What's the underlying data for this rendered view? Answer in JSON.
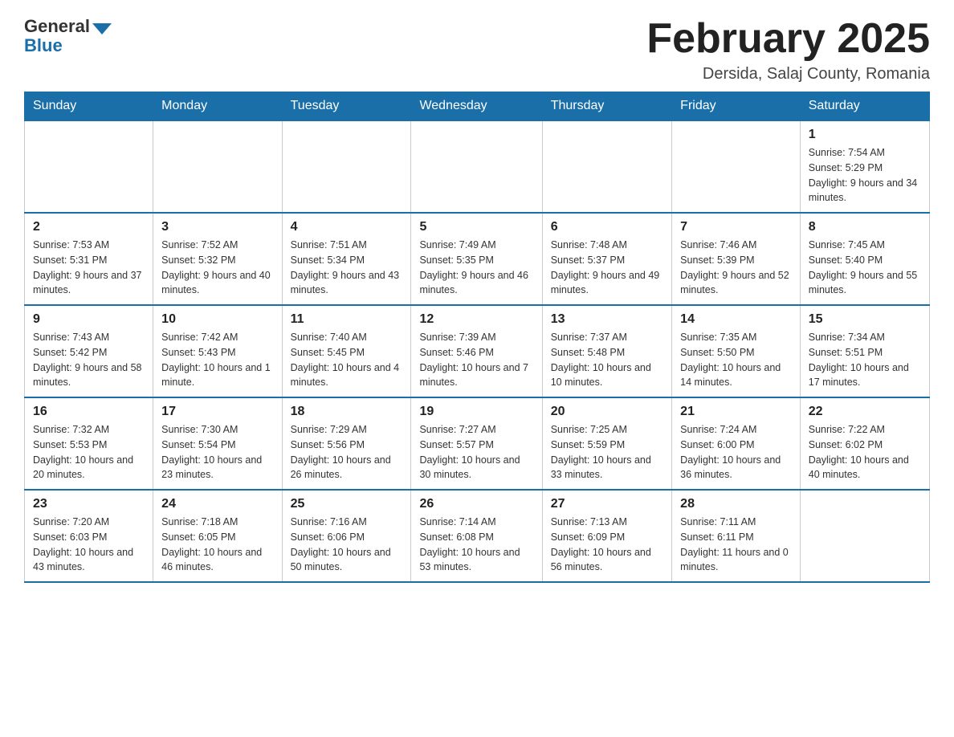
{
  "header": {
    "logo_general": "General",
    "logo_blue": "Blue",
    "month_title": "February 2025",
    "location": "Dersida, Salaj County, Romania"
  },
  "weekdays": [
    "Sunday",
    "Monday",
    "Tuesday",
    "Wednesday",
    "Thursday",
    "Friday",
    "Saturday"
  ],
  "weeks": [
    [
      {
        "day": "",
        "info": ""
      },
      {
        "day": "",
        "info": ""
      },
      {
        "day": "",
        "info": ""
      },
      {
        "day": "",
        "info": ""
      },
      {
        "day": "",
        "info": ""
      },
      {
        "day": "",
        "info": ""
      },
      {
        "day": "1",
        "info": "Sunrise: 7:54 AM\nSunset: 5:29 PM\nDaylight: 9 hours and 34 minutes."
      }
    ],
    [
      {
        "day": "2",
        "info": "Sunrise: 7:53 AM\nSunset: 5:31 PM\nDaylight: 9 hours and 37 minutes."
      },
      {
        "day": "3",
        "info": "Sunrise: 7:52 AM\nSunset: 5:32 PM\nDaylight: 9 hours and 40 minutes."
      },
      {
        "day": "4",
        "info": "Sunrise: 7:51 AM\nSunset: 5:34 PM\nDaylight: 9 hours and 43 minutes."
      },
      {
        "day": "5",
        "info": "Sunrise: 7:49 AM\nSunset: 5:35 PM\nDaylight: 9 hours and 46 minutes."
      },
      {
        "day": "6",
        "info": "Sunrise: 7:48 AM\nSunset: 5:37 PM\nDaylight: 9 hours and 49 minutes."
      },
      {
        "day": "7",
        "info": "Sunrise: 7:46 AM\nSunset: 5:39 PM\nDaylight: 9 hours and 52 minutes."
      },
      {
        "day": "8",
        "info": "Sunrise: 7:45 AM\nSunset: 5:40 PM\nDaylight: 9 hours and 55 minutes."
      }
    ],
    [
      {
        "day": "9",
        "info": "Sunrise: 7:43 AM\nSunset: 5:42 PM\nDaylight: 9 hours and 58 minutes."
      },
      {
        "day": "10",
        "info": "Sunrise: 7:42 AM\nSunset: 5:43 PM\nDaylight: 10 hours and 1 minute."
      },
      {
        "day": "11",
        "info": "Sunrise: 7:40 AM\nSunset: 5:45 PM\nDaylight: 10 hours and 4 minutes."
      },
      {
        "day": "12",
        "info": "Sunrise: 7:39 AM\nSunset: 5:46 PM\nDaylight: 10 hours and 7 minutes."
      },
      {
        "day": "13",
        "info": "Sunrise: 7:37 AM\nSunset: 5:48 PM\nDaylight: 10 hours and 10 minutes."
      },
      {
        "day": "14",
        "info": "Sunrise: 7:35 AM\nSunset: 5:50 PM\nDaylight: 10 hours and 14 minutes."
      },
      {
        "day": "15",
        "info": "Sunrise: 7:34 AM\nSunset: 5:51 PM\nDaylight: 10 hours and 17 minutes."
      }
    ],
    [
      {
        "day": "16",
        "info": "Sunrise: 7:32 AM\nSunset: 5:53 PM\nDaylight: 10 hours and 20 minutes."
      },
      {
        "day": "17",
        "info": "Sunrise: 7:30 AM\nSunset: 5:54 PM\nDaylight: 10 hours and 23 minutes."
      },
      {
        "day": "18",
        "info": "Sunrise: 7:29 AM\nSunset: 5:56 PM\nDaylight: 10 hours and 26 minutes."
      },
      {
        "day": "19",
        "info": "Sunrise: 7:27 AM\nSunset: 5:57 PM\nDaylight: 10 hours and 30 minutes."
      },
      {
        "day": "20",
        "info": "Sunrise: 7:25 AM\nSunset: 5:59 PM\nDaylight: 10 hours and 33 minutes."
      },
      {
        "day": "21",
        "info": "Sunrise: 7:24 AM\nSunset: 6:00 PM\nDaylight: 10 hours and 36 minutes."
      },
      {
        "day": "22",
        "info": "Sunrise: 7:22 AM\nSunset: 6:02 PM\nDaylight: 10 hours and 40 minutes."
      }
    ],
    [
      {
        "day": "23",
        "info": "Sunrise: 7:20 AM\nSunset: 6:03 PM\nDaylight: 10 hours and 43 minutes."
      },
      {
        "day": "24",
        "info": "Sunrise: 7:18 AM\nSunset: 6:05 PM\nDaylight: 10 hours and 46 minutes."
      },
      {
        "day": "25",
        "info": "Sunrise: 7:16 AM\nSunset: 6:06 PM\nDaylight: 10 hours and 50 minutes."
      },
      {
        "day": "26",
        "info": "Sunrise: 7:14 AM\nSunset: 6:08 PM\nDaylight: 10 hours and 53 minutes."
      },
      {
        "day": "27",
        "info": "Sunrise: 7:13 AM\nSunset: 6:09 PM\nDaylight: 10 hours and 56 minutes."
      },
      {
        "day": "28",
        "info": "Sunrise: 7:11 AM\nSunset: 6:11 PM\nDaylight: 11 hours and 0 minutes."
      },
      {
        "day": "",
        "info": ""
      }
    ]
  ]
}
